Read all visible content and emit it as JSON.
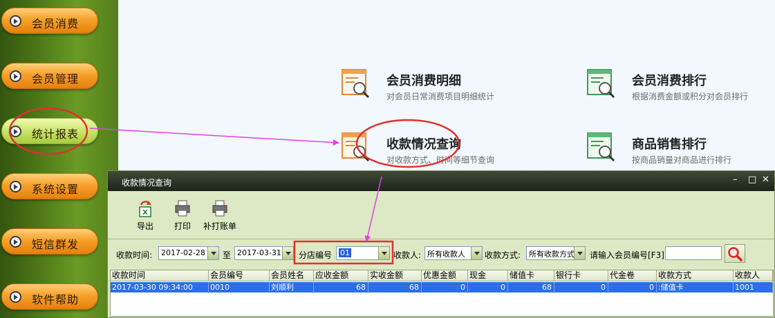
{
  "sidebar": {
    "items": [
      {
        "label": "会员消费"
      },
      {
        "label": "会员管理"
      },
      {
        "label": "统计报表"
      },
      {
        "label": "系统设置"
      },
      {
        "label": "短信群发"
      },
      {
        "label": "软件帮助"
      }
    ]
  },
  "menu": {
    "tiles": [
      {
        "title": "会员消费明细",
        "desc": "对会员日常消费项目明细统计"
      },
      {
        "title": "会员消费排行",
        "desc": "根据消费金额或积分对会员排行"
      },
      {
        "title": "收款情况查询",
        "desc": "对收款方式、时间等细节查询"
      },
      {
        "title": "商品销售排行",
        "desc": "按商品销量对商品进行排行"
      }
    ]
  },
  "dialog": {
    "title": "收款情况查询",
    "window_buttons": {
      "minimize": "–",
      "maximize": "□",
      "close": "✕"
    },
    "toolbar": {
      "export": "导出",
      "print": "打印",
      "reprint": "补打账单"
    },
    "filters": {
      "time_label": "收款时间:",
      "date_from": "2017-02-28",
      "to_label": "至",
      "date_to": "2017-03-31",
      "branch_label": "分店编号",
      "branch_value": "01",
      "cashier_label": "收款人:",
      "cashier_value": "所有收款人",
      "method_label": "收款方式:",
      "method_value": "所有收款方式",
      "member_prompt": "请输入会员编号[F3]",
      "member_value": ""
    },
    "table": {
      "columns": [
        "收款时间",
        "会员编号",
        "会员姓名",
        "应收金额",
        "实收金额",
        "优惠金额",
        "现金",
        "储值卡",
        "银行卡",
        "代金卷",
        "收款方式",
        "收款人"
      ],
      "rows": [
        [
          "2017-03-30 09:34:00",
          "0010",
          "刘顺利",
          "68",
          "68",
          "0",
          "0",
          "68",
          "0",
          "0",
          ":储值卡",
          "1001"
        ]
      ]
    }
  },
  "colors": {
    "annotation_red": "#e03030",
    "annotation_magenta": "#e040e8",
    "selection_blue": "#2a6fe6"
  }
}
